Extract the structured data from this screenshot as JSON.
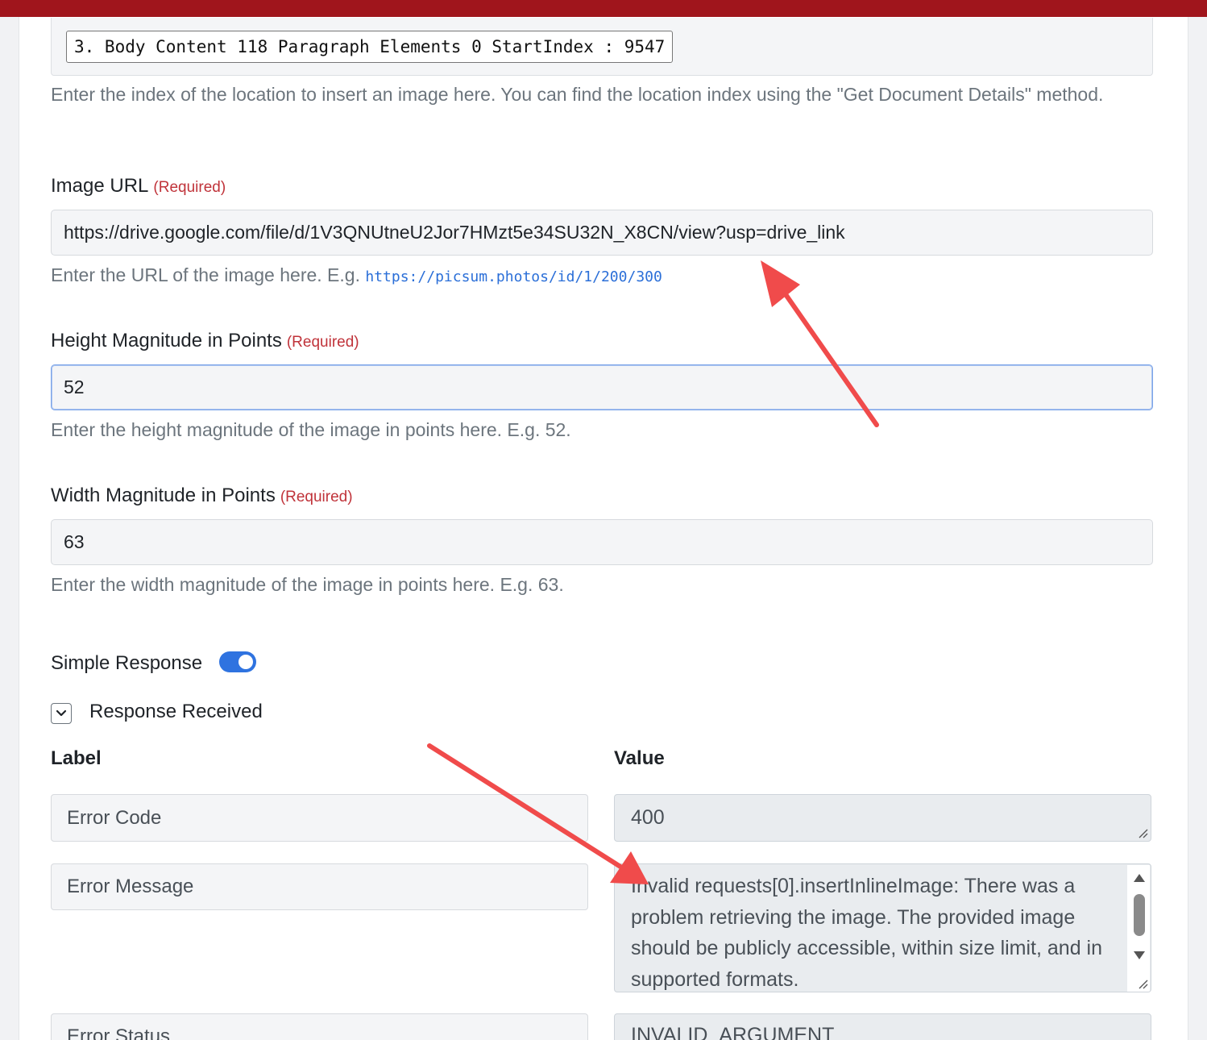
{
  "location_index": {
    "value": "3. Body Content 118 Paragraph Elements 0 StartIndex : 9547",
    "help": "Enter the index of the location to insert an image here. You can find the location index using the \"Get Document Details\" method."
  },
  "image_url": {
    "label": "Image URL",
    "required": "(Required)",
    "value": "https://drive.google.com/file/d/1V3QNUtneU2Jor7HMzt5e34SU32N_X8CN/view?usp=drive_link",
    "help": "Enter the URL of the image here. E.g.",
    "example": "https://picsum.photos/id/1/200/300"
  },
  "height": {
    "label": "Height Magnitude in Points",
    "required": "(Required)",
    "value": "52",
    "help": "Enter the height magnitude of the image in points here. E.g. 52."
  },
  "width": {
    "label": "Width Magnitude in Points",
    "required": "(Required)",
    "value": "63",
    "help": "Enter the width magnitude of the image in points here. E.g. 63."
  },
  "simple_response": {
    "label": "Simple Response",
    "enabled": true
  },
  "response": {
    "title": "Response Received",
    "label_header": "Label",
    "value_header": "Value",
    "rows": [
      {
        "label": "Error Code",
        "value": "400"
      },
      {
        "label": "Error Message",
        "value": "Invalid requests[0].insertInlineImage: There was a problem retrieving the image. The provided image should be publicly accessible, within size limit, and in supported formats."
      },
      {
        "label": "Error Status",
        "value": "INVALID_ARGUMENT"
      }
    ]
  },
  "colors": {
    "topbar": "#a0151c",
    "accent": "#2f73e0",
    "required": "#c0333a",
    "annotation_arrow": "#f04b4b"
  }
}
